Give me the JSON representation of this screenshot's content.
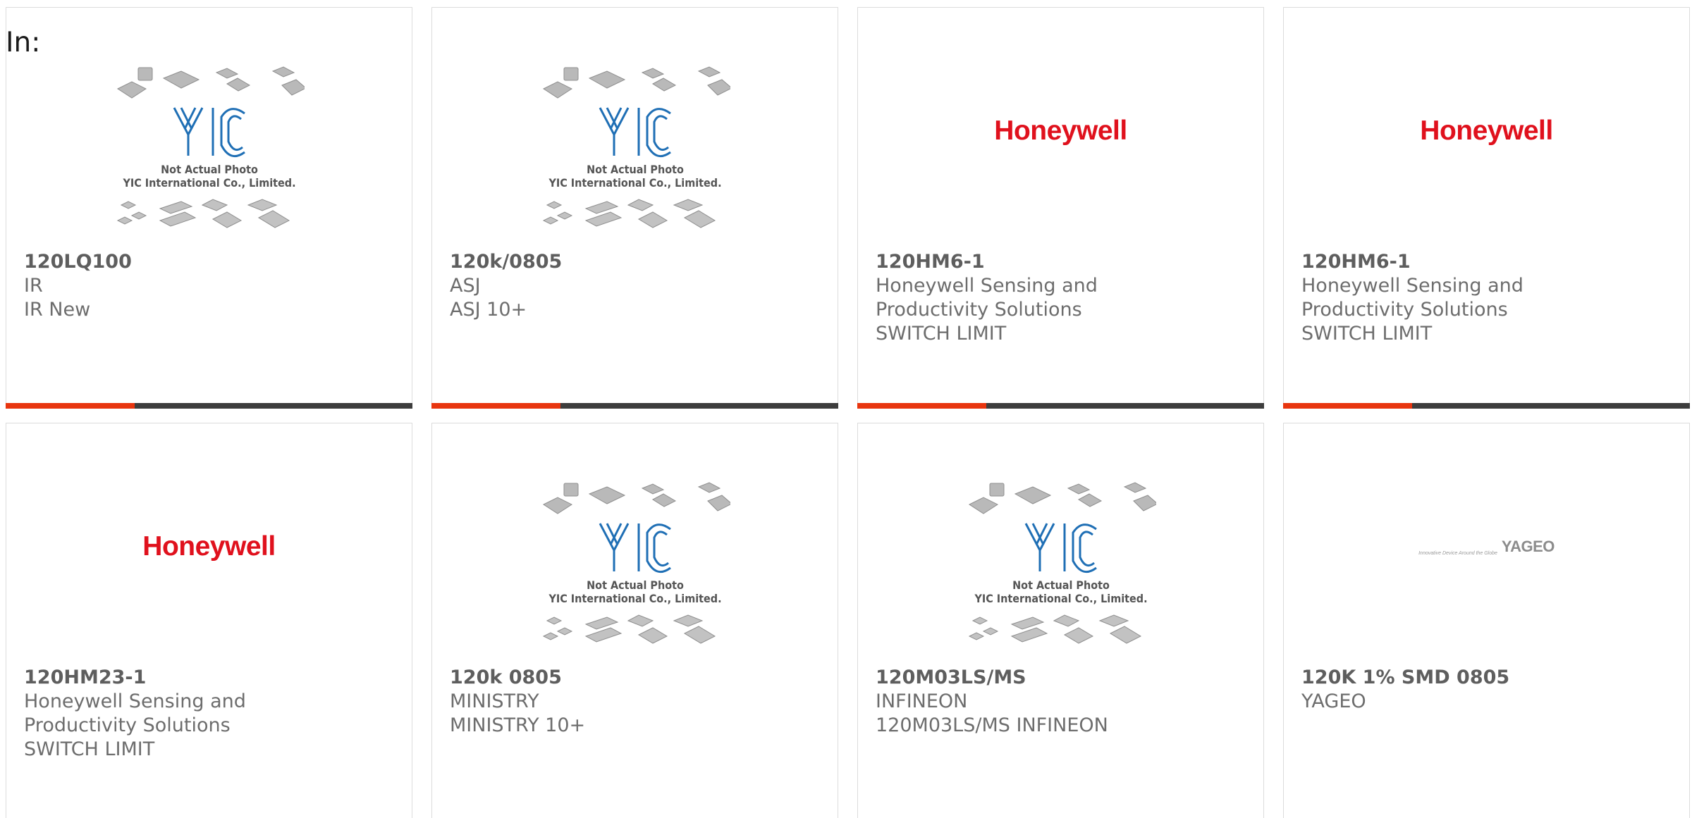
{
  "filter_label": "In:",
  "placeholder": {
    "caption_line1": "Not Actual Photo",
    "caption_line2": "YIC International Co., Limited.",
    "logo_text": "YIC"
  },
  "cards": [
    {
      "image": "yic-placeholder",
      "part": "120LQ100",
      "lines": [
        "IR",
        "IR New"
      ]
    },
    {
      "image": "yic-placeholder",
      "part": "120k/0805",
      "lines": [
        "ASJ",
        "ASJ 10+"
      ]
    },
    {
      "image": "honeywell-logo",
      "logo_text": "Honeywell",
      "part": "120HM6-1",
      "lines": [
        "Honeywell Sensing and",
        "Productivity Solutions",
        "SWITCH LIMIT"
      ]
    },
    {
      "image": "honeywell-logo",
      "logo_text": "Honeywell",
      "part": "120HM6-1",
      "lines": [
        "Honeywell Sensing and",
        "Productivity Solutions",
        "SWITCH LIMIT"
      ]
    },
    {
      "image": "honeywell-logo",
      "logo_text": "Honeywell",
      "part": "120HM23-1",
      "lines": [
        "Honeywell Sensing and",
        "Productivity Solutions",
        "SWITCH LIMIT"
      ]
    },
    {
      "image": "yic-placeholder",
      "part": "120k 0805",
      "lines": [
        "MINISTRY",
        "MINISTRY 10+"
      ]
    },
    {
      "image": "yic-placeholder",
      "part": "120M03LS/MS",
      "lines": [
        "INFINEON",
        "120M03LS/MS INFINEON"
      ]
    },
    {
      "image": "yageo-logo",
      "logo_text": "YAGEO",
      "tagline": "Innovative Device Around the Globe",
      "part": "120K 1% SMD 0805",
      "lines": [
        "YAGEO"
      ]
    }
  ],
  "colors": {
    "accent": "#e8350f",
    "bar": "#3d3d3d",
    "honeywell": "#e0111d",
    "yic_blue": "#1f6fb5"
  }
}
